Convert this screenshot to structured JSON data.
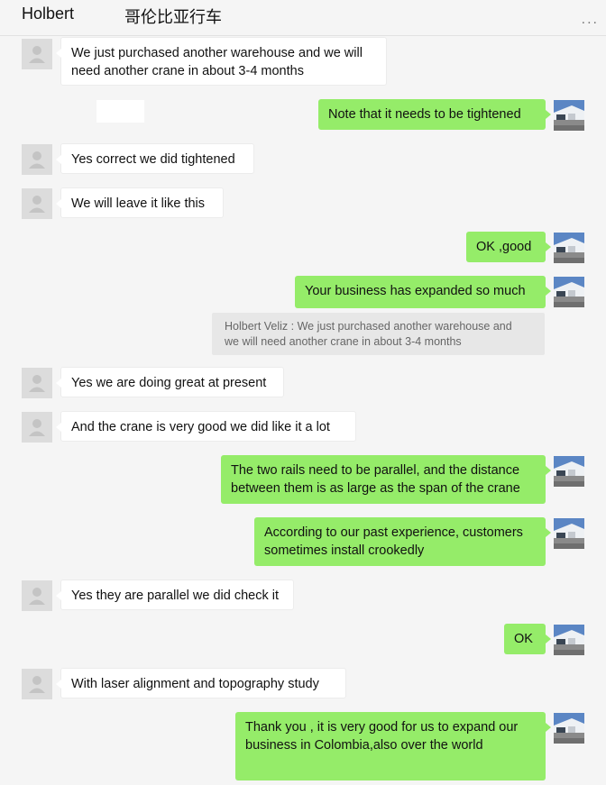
{
  "header": {
    "name": "Holbert",
    "subtitle": "哥伦比亚行车",
    "more": "..."
  },
  "messages": [
    {
      "side": "in",
      "text": "We just purchased another warehouse and we will\nneed another crane in about 3-4 months"
    },
    {
      "side": "out",
      "text": "Note that it needs to be tightened"
    },
    {
      "side": "in",
      "text": "Yes correct we did tightened"
    },
    {
      "side": "in",
      "text": "We will leave it like this"
    },
    {
      "side": "out",
      "text": "OK ,good"
    },
    {
      "side": "out",
      "text": "Your business has expanded so much"
    },
    {
      "side": "quote",
      "text": "Holbert Veliz : We just purchased another warehouse and\nwe will need another crane in about 3-4 months"
    },
    {
      "side": "in",
      "text": "Yes we are doing great at present"
    },
    {
      "side": "in",
      "text": "And the crane is very good we did like it a lot"
    },
    {
      "side": "out",
      "text": "The two rails need to be parallel, and the distance\nbetween them is as large as the span of the crane"
    },
    {
      "side": "out",
      "text": "According to our past experience, customers\nsometimes install crookedly"
    },
    {
      "side": "in",
      "text": "Yes they are parallel we did check it"
    },
    {
      "side": "out",
      "text": "OK"
    },
    {
      "side": "in",
      "text": "With laser alignment and topography study"
    },
    {
      "side": "out",
      "text": "Thank you , it is very good for us to expand our\nbusiness in Colombia,also over the world"
    }
  ],
  "colors": {
    "outgoing_bubble": "#95ec69",
    "incoming_bubble": "#ffffff",
    "background": "#f5f5f5",
    "quote_background": "#e7e7e7"
  },
  "icons": {
    "contact_avatar": "default-person-icon",
    "my_avatar": "warehouse-photo-avatar",
    "more": "ellipsis-icon"
  }
}
